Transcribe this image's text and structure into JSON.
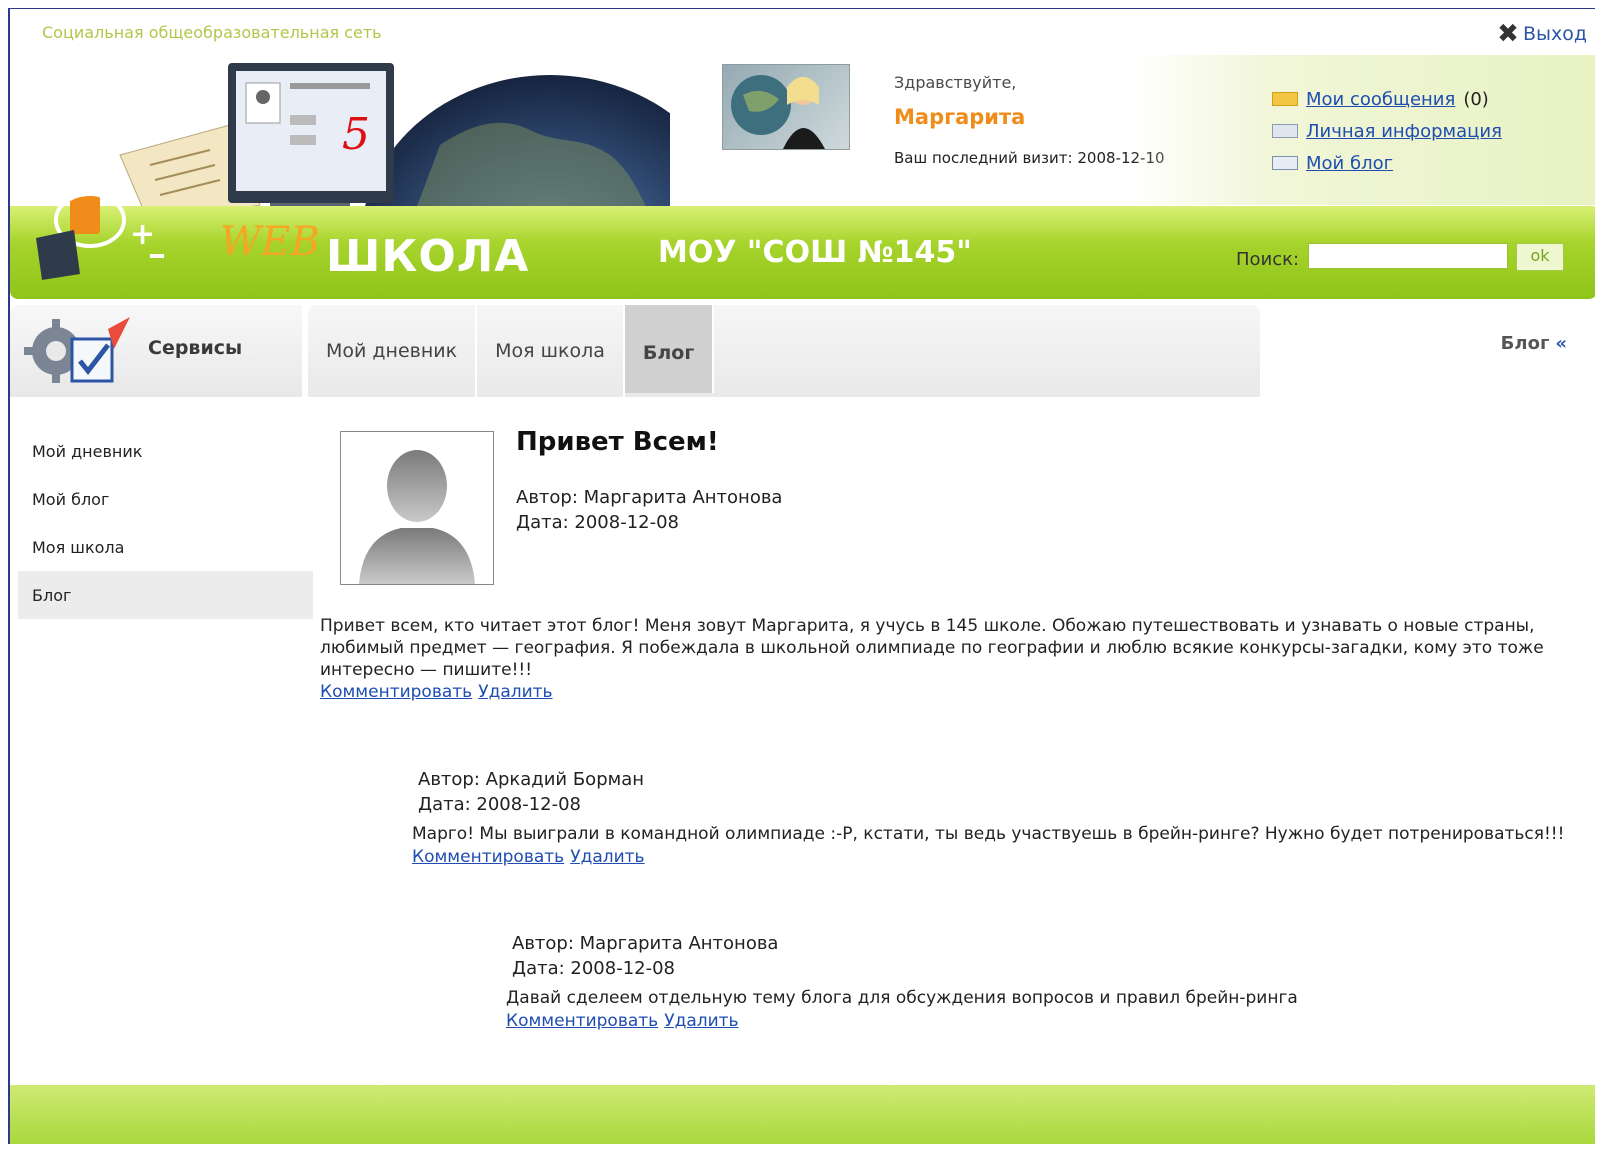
{
  "header": {
    "network_title": "Социальная общеобразовательная сеть",
    "logout_label": "Выход",
    "greeting": "Здравствуйте,",
    "user_name": "Маргарита",
    "last_visit_label": "Ваш последний визит:",
    "last_visit_date": "2008-12-10",
    "quick_links": [
      {
        "label": "Мои сообщения",
        "count": "(0)",
        "icon": "envelope-icon"
      },
      {
        "label": "Личная информация",
        "icon": "id-card-icon"
      },
      {
        "label": "Мой блог",
        "icon": "blog-icon"
      }
    ],
    "logo_web": "WEB",
    "logo_school": "ШКОЛА",
    "school_name": "МОУ \"СОШ №145\"",
    "search_label": "Поиск:",
    "search_value": "",
    "search_button": "ok"
  },
  "nav": {
    "services_label": "Сервисы",
    "tabs": [
      "Мой дневник",
      "Моя школа",
      "Блог"
    ],
    "active_tab": "Блог",
    "breadcrumb": "Блог",
    "breadcrumb_chevron": "«"
  },
  "sidebar": {
    "items": [
      "Мой дневник",
      "Мой блог",
      "Моя школа",
      "Блог"
    ],
    "active": "Блог"
  },
  "post": {
    "title": "Привет Всем!",
    "author": "Автор: Маргарита Антонова",
    "date": "Дата: 2008-12-08",
    "body": "Привет всем, кто читает этот блог! Меня зовут Маргарита, я учусь в 145 школе. Обожаю путешествовать и узнавать о новые страны, любимый предмет — география. Я побеждала в школьной олимпиаде по географии и люблю всякие конкурсы-загадки, кому это тоже интересно — пишите!!!",
    "comment_link": "Комментировать",
    "delete_link": "Удалить"
  },
  "comments": [
    {
      "author": "Автор: Аркадий Борман",
      "date": "Дата: 2008-12-08",
      "text": "Марго! Мы выиграли в командной олимпиаде :-Р, кстати, ты ведь участвуешь в брейн-ринге? Нужно будет потренироваться!!!",
      "comment_link": "Комментировать",
      "delete_link": "Удалить"
    },
    {
      "author": "Автор: Маргарита Антонова",
      "date": "Дата: 2008-12-08",
      "text": "Давай сделеем отдельную тему блога для обсуждения вопросов и правил брейн-ринга",
      "comment_link": "Комментировать",
      "delete_link": "Удалить"
    }
  ],
  "colors": {
    "brand_green": "#a7d42c",
    "link_blue": "#1f4db2",
    "accent_orange": "#f08c1a"
  }
}
